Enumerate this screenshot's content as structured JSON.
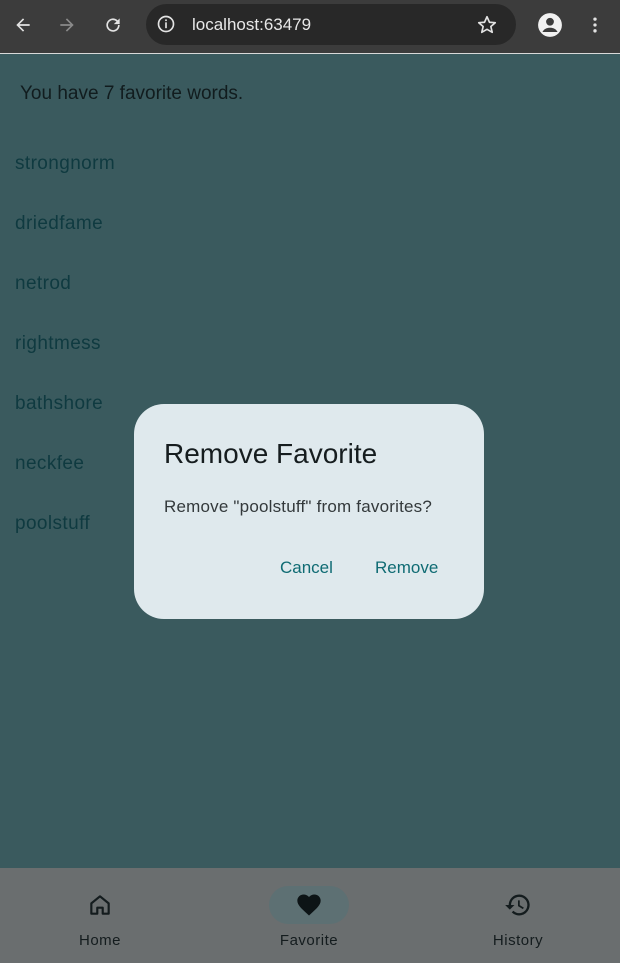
{
  "browser": {
    "url": "localhost:63479"
  },
  "page": {
    "count_text": "You have 7 favorite words.",
    "favorites": [
      "strongnorm",
      "driedfame",
      "netrod",
      "rightmess",
      "bathshore",
      "neckfee",
      "poolstuff"
    ]
  },
  "dialog": {
    "title": "Remove Favorite",
    "message": "Remove \"poolstuff\" from favorites?",
    "cancel_label": "Cancel",
    "remove_label": "Remove"
  },
  "nav": {
    "items": [
      {
        "label": "Home",
        "icon": "home-icon",
        "active": false
      },
      {
        "label": "Favorite",
        "icon": "heart-icon",
        "active": true
      },
      {
        "label": "History",
        "icon": "history-icon",
        "active": false
      }
    ]
  },
  "colors": {
    "page_background": "#3a5a5e",
    "dialog_background": "#dfe9ed",
    "accent": "#0f6b73",
    "bottom_nav_background": "#6a6e6f"
  }
}
